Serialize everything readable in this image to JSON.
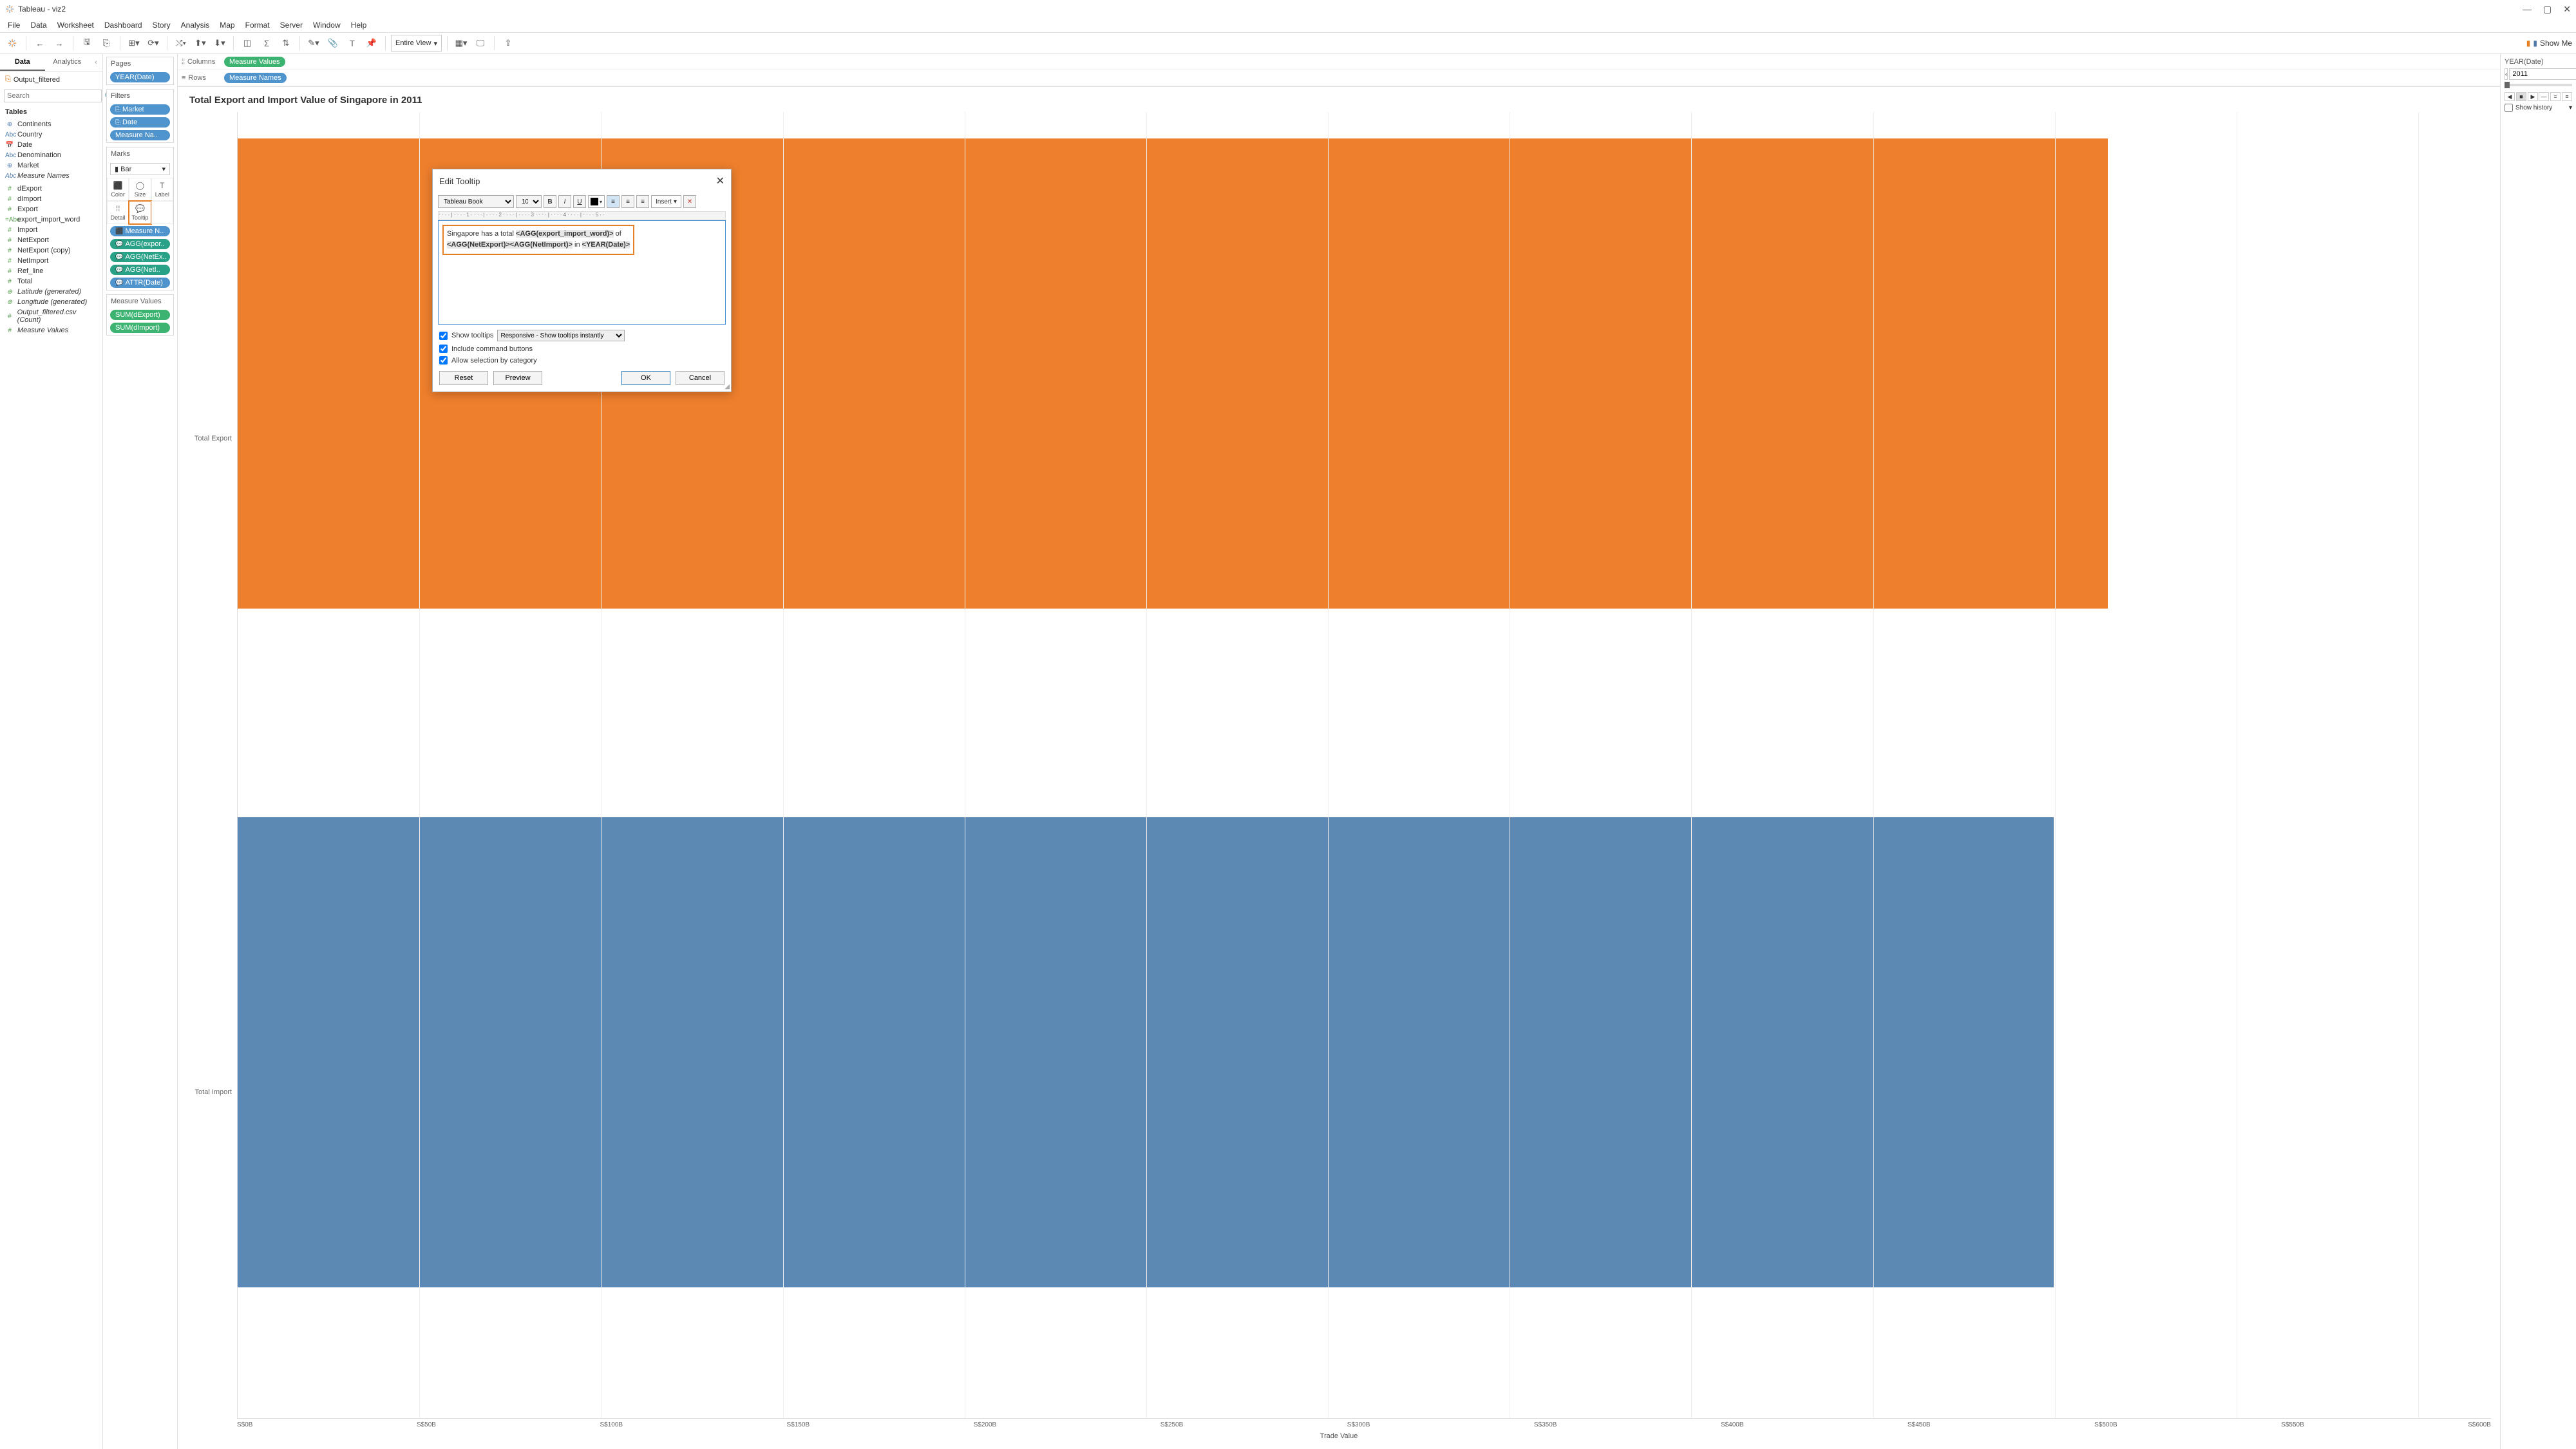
{
  "window": {
    "title": "Tableau - viz2"
  },
  "menu": [
    "File",
    "Data",
    "Worksheet",
    "Dashboard",
    "Story",
    "Analysis",
    "Map",
    "Format",
    "Server",
    "Window",
    "Help"
  ],
  "toolbar": {
    "viewmode": "Entire View",
    "showme": "Show Me"
  },
  "left": {
    "tabs": {
      "data": "Data",
      "analytics": "Analytics"
    },
    "datasource": "Output_filtered",
    "search_placeholder": "Search",
    "tables_hdr": "Tables",
    "dims": [
      {
        "icon": "⊕",
        "label": "Continents"
      },
      {
        "icon": "Abc",
        "label": "Country"
      },
      {
        "icon": "📅",
        "label": "Date"
      },
      {
        "icon": "Abc",
        "label": "Denomination"
      },
      {
        "icon": "⊕",
        "label": "Market"
      },
      {
        "icon": "Abc",
        "label": "Measure Names",
        "italic": true
      }
    ],
    "meas": [
      {
        "icon": "#",
        "label": "dExport"
      },
      {
        "icon": "#",
        "label": "dImport"
      },
      {
        "icon": "#",
        "label": "Export"
      },
      {
        "icon": "=Abc",
        "label": "export_import_word"
      },
      {
        "icon": "#",
        "label": "Import"
      },
      {
        "icon": "#",
        "label": "NetExport"
      },
      {
        "icon": "#",
        "label": "NetExport (copy)"
      },
      {
        "icon": "#",
        "label": "NetImport"
      },
      {
        "icon": "#",
        "label": "Ref_line"
      },
      {
        "icon": "#",
        "label": "Total"
      },
      {
        "icon": "⊕",
        "label": "Latitude (generated)",
        "italic": true
      },
      {
        "icon": "⊕",
        "label": "Longitude (generated)",
        "italic": true
      },
      {
        "icon": "#",
        "label": "Output_filtered.csv (Count)",
        "italic": true
      },
      {
        "icon": "#",
        "label": "Measure Values",
        "italic": true
      }
    ]
  },
  "cards": {
    "pages_hdr": "Pages",
    "pages_pill": "YEAR(Date)",
    "filters_hdr": "Filters",
    "filters": [
      "Market",
      "Date",
      "Measure Na.."
    ],
    "marks_hdr": "Marks",
    "marks_type": "Bar",
    "mark_cells": [
      "Color",
      "Size",
      "Label",
      "Detail",
      "Tooltip",
      ""
    ],
    "mark_pills": [
      "Measure N..",
      "AGG(expor..",
      "AGG(NetEx..",
      "AGG(NetI..",
      "ATTR(Date)"
    ],
    "mv_hdr": "Measure Values",
    "mv_pills": [
      "SUM(dExport)",
      "SUM(dImport)"
    ]
  },
  "shelves": {
    "columns_label": "Columns",
    "columns_pill": "Measure Values",
    "rows_label": "Rows",
    "rows_pill": "Measure Names"
  },
  "viz": {
    "title": "Total Export and Import Value of Singapore in 2011",
    "ycats": [
      "Total Export",
      "Total Import"
    ],
    "xlabel": "Trade Value",
    "ticks": [
      "S$0B",
      "S$50B",
      "S$100B",
      "S$150B",
      "S$200B",
      "S$250B",
      "S$300B",
      "S$350B",
      "S$400B",
      "S$450B",
      "S$500B",
      "S$550B",
      "S$600B"
    ]
  },
  "chart_data": {
    "type": "bar",
    "orientation": "horizontal",
    "categories": [
      "Total Export",
      "Total Import"
    ],
    "values": [
      515,
      500
    ],
    "unit": "S$ Billions",
    "xlim": [
      0,
      620
    ],
    "xlabel": "Trade Value",
    "title": "Total Export and Import Value of Singapore in 2011",
    "colors": [
      "#ee7f2d",
      "#5b89b4"
    ]
  },
  "right": {
    "hdr": "YEAR(Date)",
    "year": "2011",
    "showhist": "Show history"
  },
  "dialog": {
    "title": "Edit Tooltip",
    "font": "Tableau Book",
    "size": "10",
    "insert": "Insert",
    "text_prefix": "Singapore has a total ",
    "field1": "<AGG(export_import_word)>",
    "text_of": " of",
    "field2": "<AGG(NetExport)><AGG(NetImport)>",
    "text_in": " in ",
    "field3": "<YEAR(Date)>",
    "show_tooltips": "Show tooltips",
    "tooltip_mode": "Responsive - Show tooltips instantly",
    "include_cmd": "Include command buttons",
    "allow_sel": "Allow selection by category",
    "reset": "Reset",
    "preview": "Preview",
    "ok": "OK",
    "cancel": "Cancel"
  }
}
